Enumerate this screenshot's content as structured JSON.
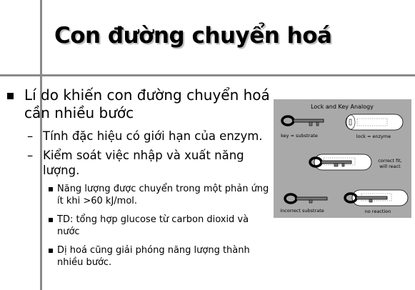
{
  "title": "Con đường chuyển hoá",
  "bullets": {
    "main": "Lí do khiến con đường chuyển hoá cần nhiều bước",
    "sub": [
      "Tính đặc hiệu có giới hạn của enzym.",
      "Kiểm soát việc nhập và xuất năng lượng."
    ],
    "subsub": [
      "Năng lượng được chuyển trong một phản ứng ít khi >60 kJ/mol.",
      "TD: tổng hợp glucose từ carbon dioxid và nước",
      "Dị hoá cũng giải phóng năng lượng thành nhiều bước."
    ]
  },
  "figure": {
    "title": "Lock and Key Analogy",
    "key_label": "key = substrate",
    "lock_label": "lock = enzyme",
    "fit_label_1": "correct fit,",
    "fit_label_2": "will react",
    "incorrect_label": "incorrect substrate",
    "no_reaction_label": "no reaction"
  }
}
